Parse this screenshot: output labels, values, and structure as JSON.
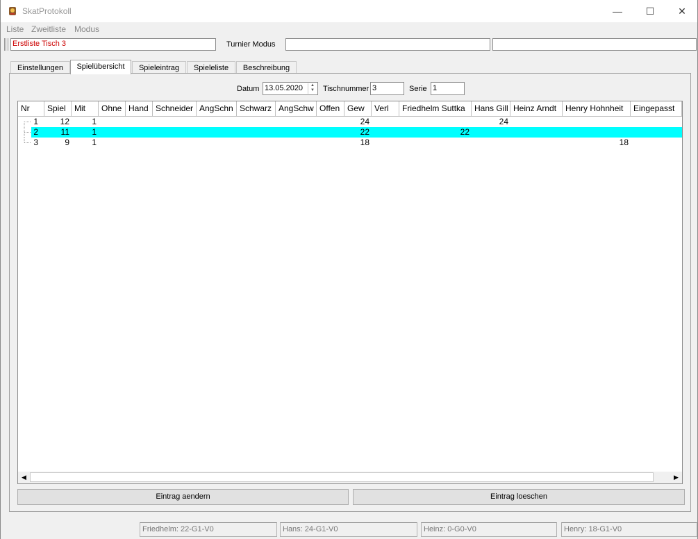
{
  "window": {
    "title": "SkatProtokoll",
    "minimize": "—",
    "maximize": "☐",
    "close": "✕"
  },
  "menu": {
    "items": [
      "Liste",
      "Zweitliste",
      "Modus"
    ]
  },
  "topbar": {
    "list_name": "Erstliste Tisch 3",
    "mode_label": "Turnier Modus",
    "field2": "",
    "field3": ""
  },
  "tabs": [
    {
      "label": "Einstellungen"
    },
    {
      "label": "Spielübersicht",
      "active": true
    },
    {
      "label": "Spieleintrag"
    },
    {
      "label": "Spieleliste"
    },
    {
      "label": "Beschreibung"
    }
  ],
  "filters": {
    "date_label": "Datum",
    "date_value": "13.05.2020",
    "table_label": "Tischnummer",
    "table_value": "3",
    "series_label": "Serie",
    "series_value": "1"
  },
  "grid": {
    "columns": [
      "Nr",
      "Spiel",
      "Mit",
      "Ohne",
      "Hand",
      "Schneider",
      "AngSchn",
      "Schwarz",
      "AngSchw",
      "Offen",
      "Gew",
      "Verl",
      "Friedhelm Suttka",
      "Hans Gill",
      "Heinz Arndt",
      "Henry Hohnheit",
      "Eingepasst"
    ],
    "rows": [
      {
        "nr": "1",
        "spiel": "12",
        "mit": "1",
        "gew": "24",
        "friedhelm": "",
        "hans": "24",
        "heinz": "",
        "henry": "",
        "selected": false
      },
      {
        "nr": "2",
        "spiel": "11",
        "mit": "1",
        "gew": "22",
        "friedhelm": "22",
        "hans": "",
        "heinz": "",
        "henry": "",
        "selected": true
      },
      {
        "nr": "3",
        "spiel": "9",
        "mit": "1",
        "gew": "18",
        "friedhelm": "",
        "hans": "",
        "heinz": "",
        "henry": "18",
        "selected": false
      }
    ],
    "scroll_left": "◀",
    "scroll_right": "▶"
  },
  "buttons": {
    "edit": "Eintrag aendern",
    "delete": "Eintrag loeschen"
  },
  "status": [
    "Friedhelm: 22-G1-V0",
    "Hans: 24-G1-V0",
    "Heinz: 0-G0-V0",
    "Henry: 18-G1-V0"
  ],
  "colors": {
    "selected_row": "#00ffff",
    "list_name": "#cc0000"
  }
}
